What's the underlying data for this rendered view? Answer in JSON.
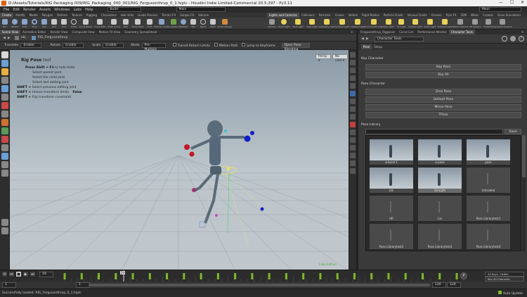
{
  "window": {
    "title": "D:/Assets/Tutorials/RIG Packaging 009/RIG_Packaging_000_001/RIG_Fergusonthrup_0_1.hiplc - Houdini Indie Limited-Commercial 20.5.297 - Py3.11",
    "minimize": "—",
    "maximize": "☐",
    "close": "✕"
  },
  "menu": {
    "items": [
      "File",
      "Edit",
      "Render",
      "Assets",
      "Windows",
      "Labs",
      "Help"
    ],
    "build": "Build",
    "desktop": "Main"
  },
  "shelf": {
    "left_tabs": [
      "Create",
      "Modify",
      "Model",
      "Polygon",
      "Deform",
      "Texture",
      "Rigging",
      "Characters",
      "Hair Utils",
      "Guide Process",
      "Terrain FX",
      "Simple FX",
      "Volume"
    ],
    "right_tabs": [
      "Lights and Cameras",
      "Collisions",
      "Particles",
      "Grains",
      "Vellum",
      "Rigid Bodies",
      "Particle Fluids",
      "Viscous Fluids",
      "Oceans",
      "Pyro FX",
      "FEM",
      "Wires",
      "Crowds",
      "Drive Simulation"
    ],
    "left_tools": [
      "Box",
      "Sphere",
      "Tube",
      "Torus",
      "Grid",
      "Null",
      "Line",
      "Circle",
      "Curve Bezier",
      "Curve Path",
      "Draw Curve",
      "Path",
      "Spray Paint",
      "Font",
      "Platonic Solids",
      "L-System",
      "Metaball",
      "File",
      "Spiral",
      "Helix",
      "Quick Shapes"
    ],
    "right_tools": [
      "Camera",
      "Point Light",
      "Spot Light",
      "Area Light",
      "Geometry Light",
      "Volume Light",
      "Distant Light",
      "Environment Light",
      "Sky Light",
      "GI Light",
      "Caustic Light",
      "Portal Light",
      "Ambient Light",
      "Stereo Camera",
      "VR Camera",
      "Switcher",
      "Gamepad Camera"
    ]
  },
  "scene_tabs": [
    "Scene View",
    "Animation Editor",
    "Render View",
    "Composite View",
    "Motion FX View",
    "Geometry Spreadsheet"
  ],
  "path": {
    "root": "obj",
    "node": "RIG_Fergusonthrup"
  },
  "opbar": {
    "translate_label": "Translate",
    "translate_value": "Enable",
    "rotate_label": "Rotate",
    "rotate_value": "Enable",
    "scale_label": "Scale",
    "scale_value": "Enable",
    "mode_label": "Mode",
    "mode_value": "Pre-Multiply",
    "toggle1": "Transit Return Limits",
    "toggle2": "Motion Path",
    "toggle3": "Jump to Keyframe",
    "button": "Open Pose Blending"
  },
  "viewport": {
    "camera_menu": "Persp ▾",
    "cam_menu": "No cam ▾",
    "tool_title": "Rig Pose",
    "tool_suffix": "tool",
    "hints": [
      {
        "key": "Press Shift + F1",
        "text": "to hide hints"
      },
      {
        "key": "",
        "text": "Select parent joint"
      },
      {
        "key": "",
        "text": "Select the child joint"
      },
      {
        "key": "",
        "text": "Select last editing joint"
      },
      {
        "key": "SHIFT +",
        "text": "Select previous editing joint"
      },
      {
        "key": "SHIFT +",
        "text": "Unlock transform limits"
      },
      {
        "key": "SHIFT +",
        "text": "Flip transform constraint"
      }
    ],
    "hint_value": "False",
    "watermark": "Indie Edition"
  },
  "right_panel": {
    "tabs": [
      "Fergusonthrup_Rigposes",
      "Curve List",
      "Performance Monitor",
      "Character Tools"
    ],
    "active_tab": "Character Tools",
    "path_field": "Character Tools",
    "sub_tabs": [
      "Pose",
      "Setup"
    ],
    "key_character_header": "Key Character",
    "key_pose": "Key Pose",
    "key_all": "Key All",
    "pose_character_header": "Pose Character",
    "zero_pose": "Zero Pose",
    "default_pose": "Default Pose",
    "mirror_pose": "Mirror Pose",
    "tpose": "TPose",
    "pose_library_header": "Pose Library",
    "save": "Save",
    "poses": [
      "a-bend 1",
      "a-pose",
      "pose",
      "kik",
      "Straight",
      "Untraded",
      "HR",
      "Lie",
      "Pose Librarytest1",
      "Pose Librarytest2",
      "Pose Librarytest3",
      "Pose Librarytest4"
    ],
    "selected_pose_index": 4
  },
  "timeline": {
    "current_frame": "1",
    "frame_field": "19",
    "start": "1",
    "end": "120",
    "range_start": "1",
    "range_end": "120",
    "range_end2": "120",
    "marker": "29",
    "keys_label": "All Keys, Visible Channels",
    "keyall_label": "Key All Channels",
    "auto_update": "Auto Update"
  },
  "status": {
    "message": "Successfully loaded: RIG_Fergusonthrup_0_1.hiplc"
  },
  "colors": {
    "accent": "#e06010",
    "selected_tab": "#4a4a4a",
    "key_marker": "#7fb92a"
  }
}
